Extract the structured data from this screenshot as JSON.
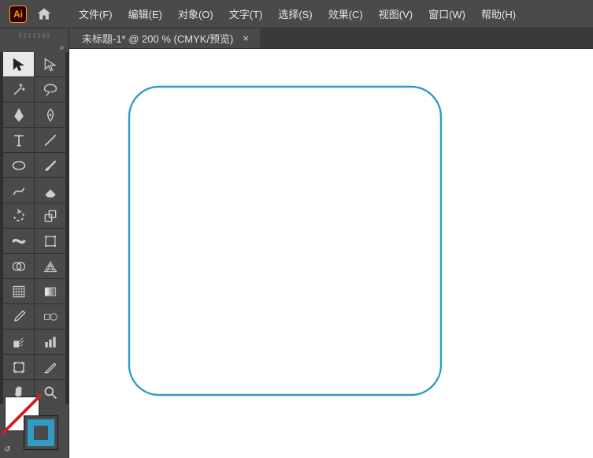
{
  "app": {
    "logo_text": "Ai"
  },
  "menu": {
    "items": [
      "文件(F)",
      "编辑(E)",
      "对象(O)",
      "文字(T)",
      "选择(S)",
      "效果(C)",
      "视图(V)",
      "窗口(W)",
      "帮助(H)"
    ]
  },
  "tab": {
    "title": "未标题-1* @ 200 % (CMYK/预览)",
    "close_glyph": "×"
  },
  "colors": {
    "shape_stroke": "#2f9cc4",
    "fill": "none"
  },
  "tools": {
    "list": [
      "selection-tool",
      "direct-selection-tool",
      "magic-wand-tool",
      "lasso-tool",
      "pen-tool",
      "curvature-tool",
      "type-tool",
      "line-segment-tool",
      "ellipse-tool",
      "paintbrush-tool",
      "shaper-tool",
      "eraser-tool",
      "rotate-tool",
      "scale-tool",
      "width-tool",
      "free-transform-tool",
      "shape-builder-tool",
      "perspective-grid-tool",
      "mesh-tool",
      "gradient-tool",
      "eyedropper-tool",
      "blend-tool",
      "symbol-sprayer-tool",
      "column-graph-tool",
      "artboard-tool",
      "slice-tool",
      "hand-tool",
      "zoom-tool"
    ],
    "selected": "selection-tool"
  },
  "toolbox": {
    "flyout_glyph": "»"
  }
}
